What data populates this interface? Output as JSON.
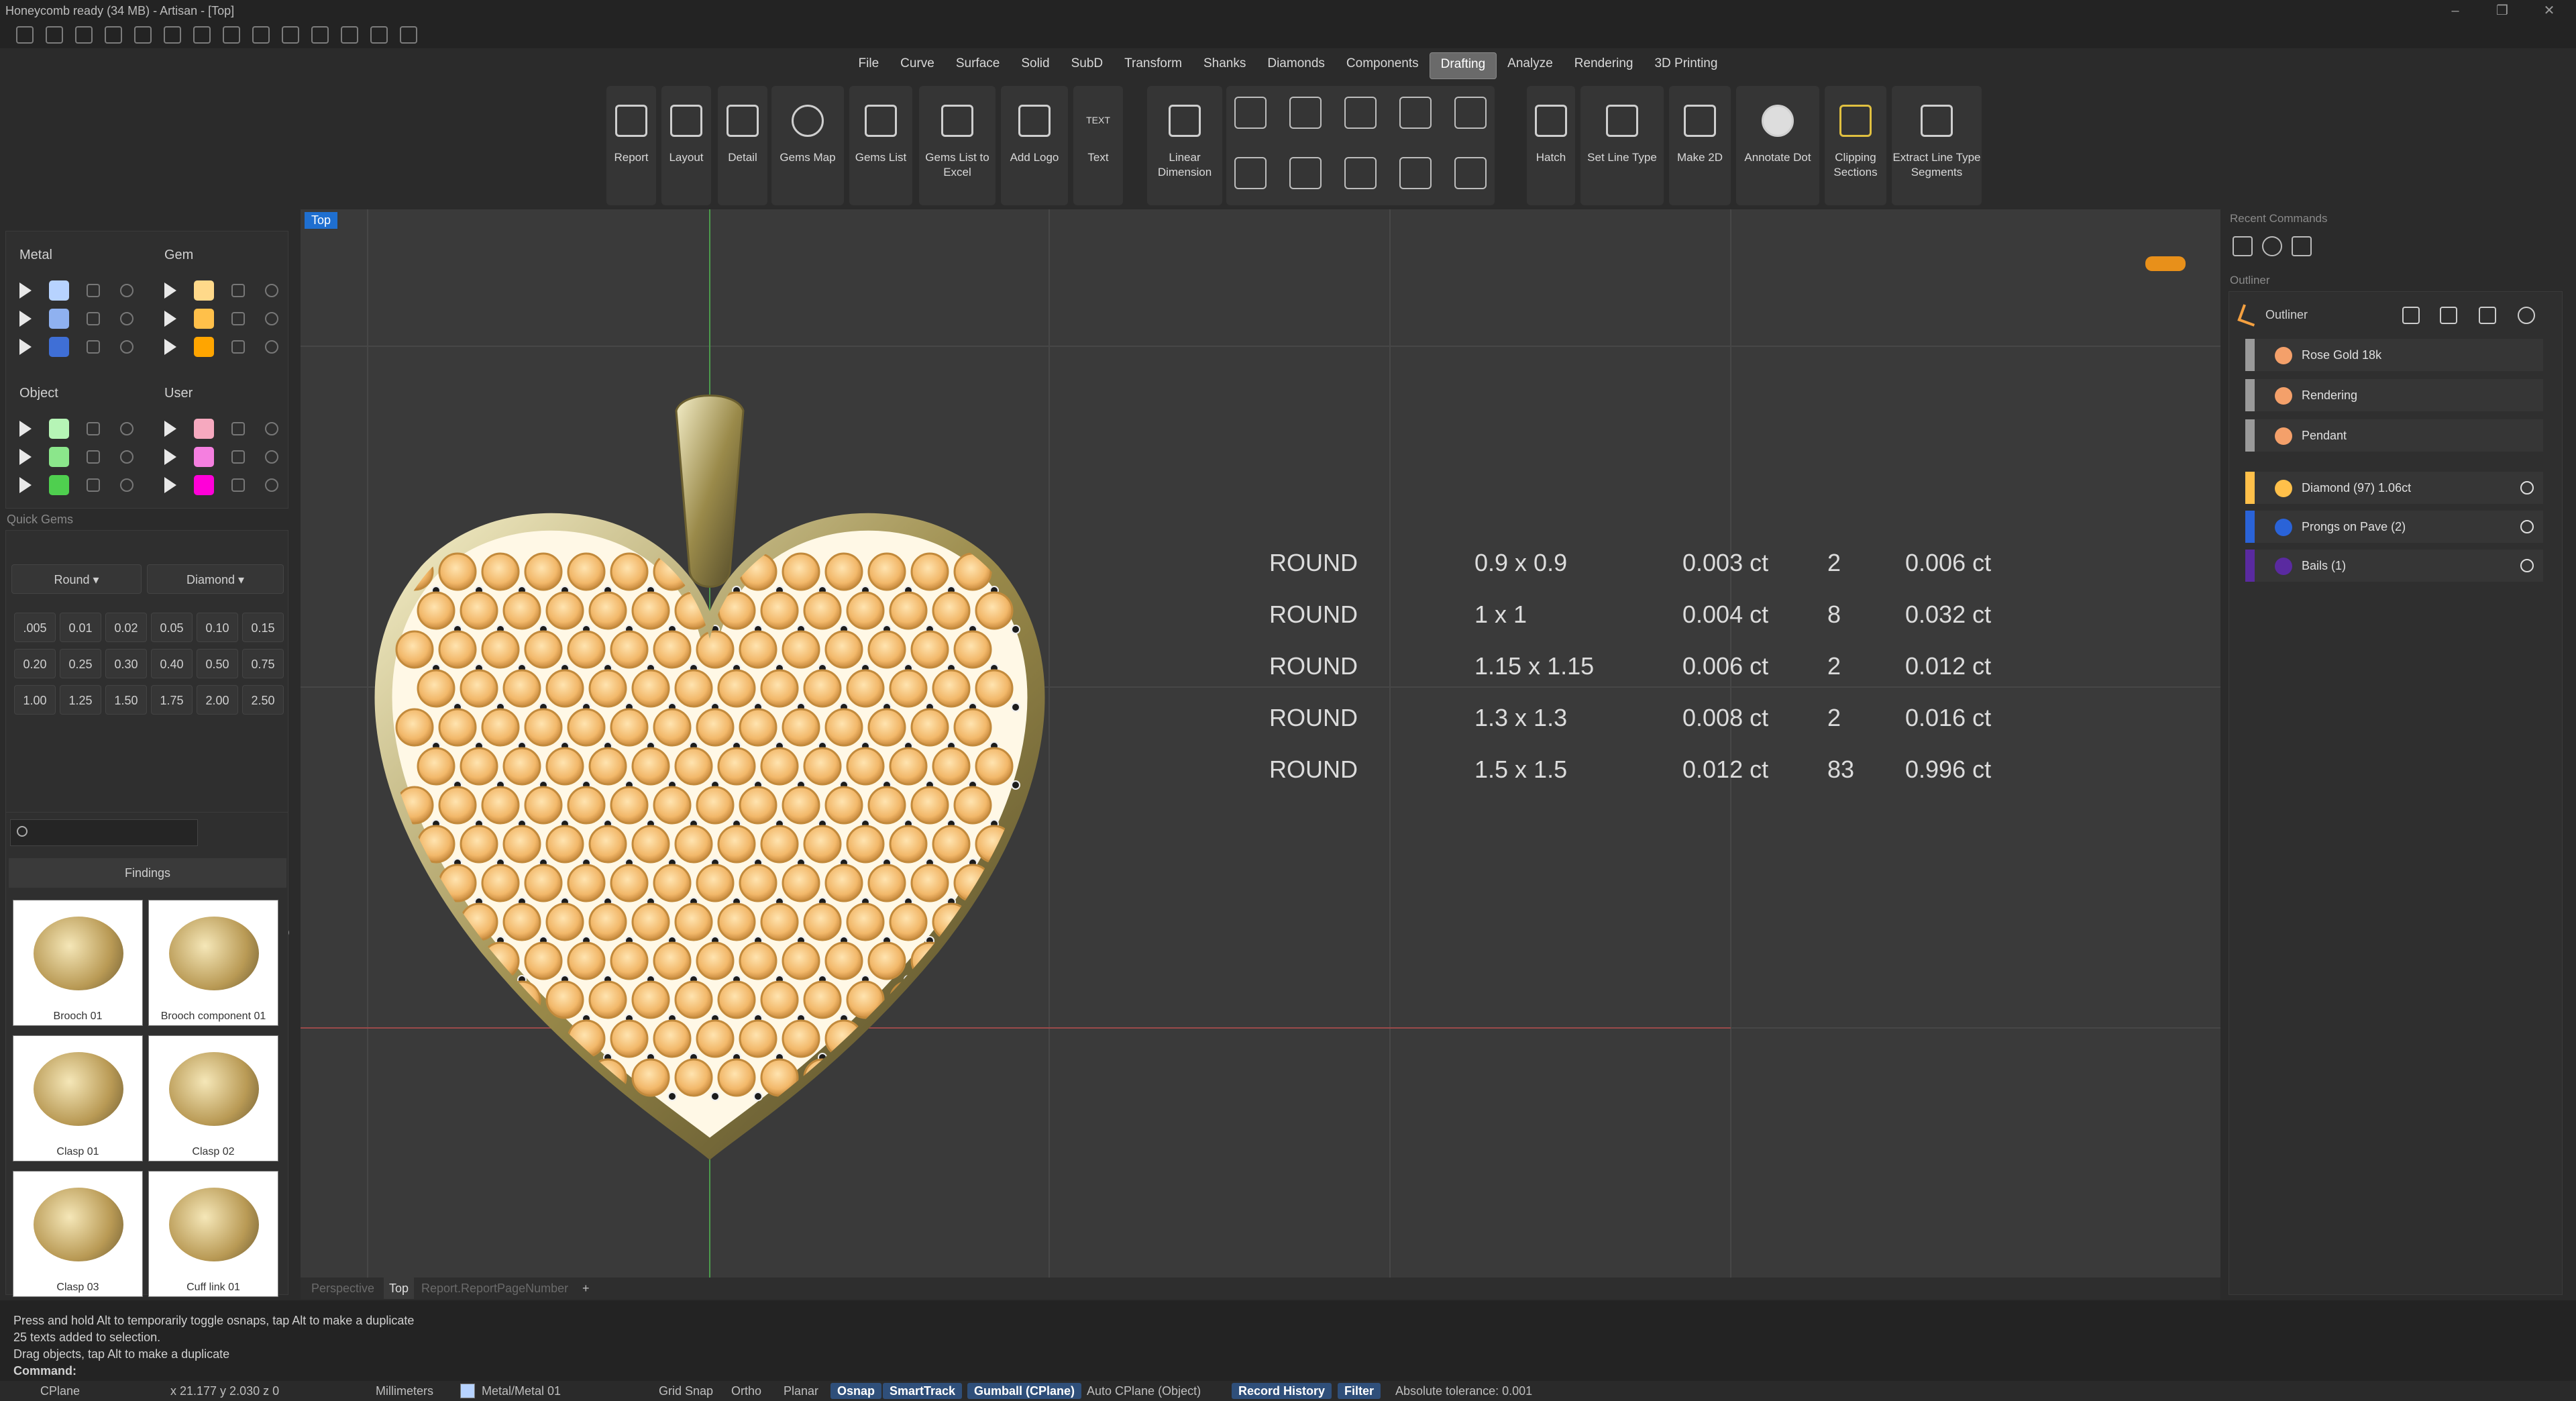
{
  "app": {
    "title": "Honeycomb ready (34 MB) - Artisan - [Top]"
  },
  "menu": {
    "items": [
      "File",
      "Curve",
      "Surface",
      "Solid",
      "SubD",
      "Transform",
      "Shanks",
      "Diamonds",
      "Components",
      "Drafting",
      "Analyze",
      "Rendering",
      "3D Printing"
    ],
    "active": "Drafting"
  },
  "ribbon": {
    "report": "Report",
    "layout": "Layout",
    "detail": "Detail",
    "gems_map": "Gems Map",
    "gems_list": "Gems List",
    "gems_list_excel": "Gems List to Excel",
    "add_logo": "Add Logo",
    "text": "Text",
    "text_icon_label": "TEXT",
    "linear_dimension": "Linear Dimension",
    "hatch": "Hatch",
    "set_line_type": "Set Line Type",
    "make_2d": "Make 2D",
    "annotate_dot": "Annotate Dot",
    "clipping_sections": "Clipping Sections",
    "extract_line_type_segments": "Extract Line Type Segments"
  },
  "layers": {
    "metal": {
      "label": "Metal",
      "colors": [
        "#b7d3ff",
        "#8fb1f0",
        "#3f6fd6"
      ]
    },
    "gem": {
      "label": "Gem",
      "colors": [
        "#ffd98a",
        "#ffc04a",
        "#ffa500"
      ]
    },
    "object": {
      "label": "Object",
      "colors": [
        "#b6f5b6",
        "#8be68b",
        "#4fcf4f"
      ]
    },
    "user": {
      "label": "User",
      "colors": [
        "#f6a9bf",
        "#f57fe0",
        "#ff00d8"
      ]
    }
  },
  "quick_gems": {
    "title": "Quick Gems",
    "shape": "Round",
    "material": "Diamond",
    "sizes": [
      ".005",
      "0.01",
      "0.02",
      "0.05",
      "0.10",
      "0.15",
      "0.20",
      "0.25",
      "0.30",
      "0.40",
      "0.50",
      "0.75",
      "1.00",
      "1.25",
      "1.50",
      "1.75",
      "2.00",
      "2.50"
    ]
  },
  "library": {
    "category": "Findings",
    "items": [
      "Brooch 01",
      "Brooch component 01",
      "Clasp 01",
      "Clasp 02",
      "Clasp 03",
      "Cuff link 01"
    ]
  },
  "viewport": {
    "name": "Top",
    "tabs": [
      "Perspective",
      "Top",
      "Report.ReportPageNumber"
    ],
    "add_tab": "+",
    "gem_table": [
      {
        "shape": "ROUND",
        "size": "0.9 x 0.9",
        "ct": "0.003 ct",
        "qty": "2",
        "total": "0.006 ct"
      },
      {
        "shape": "ROUND",
        "size": "1 x 1",
        "ct": "0.004 ct",
        "qty": "8",
        "total": "0.032 ct"
      },
      {
        "shape": "ROUND",
        "size": "1.15 x 1.15",
        "ct": "0.006 ct",
        "qty": "2",
        "total": "0.012 ct"
      },
      {
        "shape": "ROUND",
        "size": "1.3 x 1.3",
        "ct": "0.008 ct",
        "qty": "2",
        "total": "0.016 ct"
      },
      {
        "shape": "ROUND",
        "size": "1.5 x 1.5",
        "ct": "0.012 ct",
        "qty": "83",
        "total": "0.996 ct"
      }
    ]
  },
  "right_panel": {
    "recent_commands": "Recent Commands",
    "outliner_header": "Outliner",
    "outliner_title": "Outliner",
    "items": [
      {
        "label": "Rose Gold 18k",
        "color": "#f4a06a"
      },
      {
        "label": "Rendering",
        "color": "#f4a06a"
      },
      {
        "label": "Pendant",
        "color": "#f4a06a"
      },
      {
        "label": "Diamond (97) 1.06ct",
        "color": "#ffc04a"
      },
      {
        "label": "Prongs on Pave (2)",
        "color": "#2a63d8"
      },
      {
        "label": "Bails (1)",
        "color": "#5a2aa0"
      }
    ]
  },
  "command_history": [
    "Press and hold Alt to temporarily toggle osnaps, tap Alt to make a duplicate",
    "25 texts added to selection.",
    "Drag objects, tap Alt to make a duplicate"
  ],
  "command_prompt": "Command:",
  "status": {
    "cplane": "CPlane",
    "coords": "x 21.177  y 2.030  z 0",
    "units": "Millimeters",
    "layer": "Metal/Metal 01",
    "grid_snap": "Grid Snap",
    "ortho": "Ortho",
    "planar": "Planar",
    "osnap": "Osnap",
    "smarttrack": "SmartTrack",
    "gumball": "Gumball (CPlane)",
    "auto_cplane": "Auto CPlane (Object)",
    "record_history": "Record History",
    "filter": "Filter",
    "tolerance": "Absolute tolerance: 0.001"
  }
}
